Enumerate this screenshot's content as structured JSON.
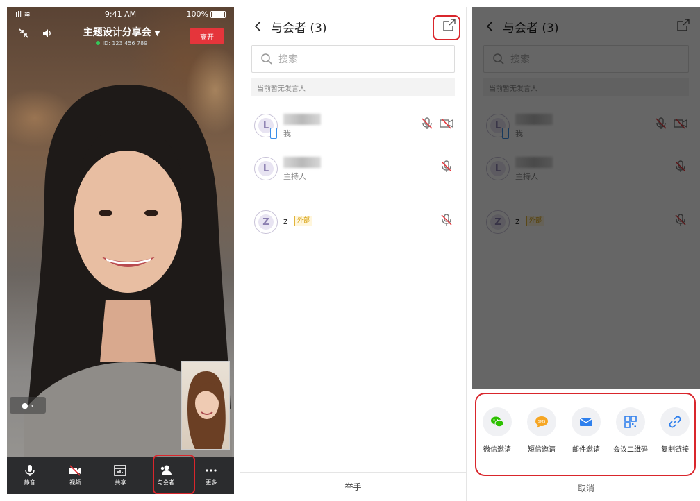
{
  "call": {
    "status_time": "9:41 AM",
    "battery": "100%",
    "meeting_title": "主题设计分享会",
    "meeting_id": "ID: 123 456 789",
    "leave_label": "离开",
    "toolbar": [
      {
        "label": "静音",
        "icon": "mic-icon"
      },
      {
        "label": "视频",
        "icon": "video-off-icon"
      },
      {
        "label": "共享",
        "icon": "share-screen-icon"
      },
      {
        "label": "与会者",
        "icon": "participants-icon"
      },
      {
        "label": "更多",
        "icon": "more-icon"
      }
    ]
  },
  "participants": {
    "title": "与会者 (3)",
    "search_placeholder": "搜索",
    "no_speaker": "当前暂无发言人",
    "list": [
      {
        "avatar": "L",
        "role": "我"
      },
      {
        "avatar": "L",
        "role": "主持人"
      },
      {
        "avatar": "Z",
        "name": "z",
        "tag": "外部"
      }
    ],
    "raise_hand": "举手"
  },
  "invite_sheet": {
    "options": [
      {
        "label": "微信邀请",
        "icon": "wechat-icon",
        "color": "#2dc100"
      },
      {
        "label": "短信邀请",
        "icon": "sms-icon",
        "color": "#f6a623"
      },
      {
        "label": "邮件邀请",
        "icon": "mail-icon",
        "color": "#2f80ed"
      },
      {
        "label": "会议二维码",
        "icon": "qrcode-icon",
        "color": "#2f80ed"
      },
      {
        "label": "复制链接",
        "icon": "link-icon",
        "color": "#2f80ed"
      }
    ],
    "cancel": "取消"
  },
  "colors": {
    "accent_red": "#e5353b",
    "highlight": "#d9262c"
  }
}
